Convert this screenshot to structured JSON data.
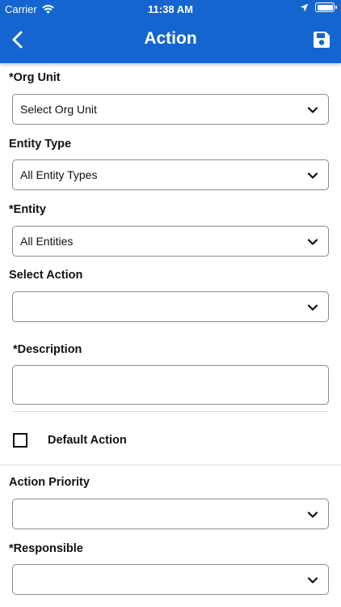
{
  "status_bar": {
    "carrier": "Carrier",
    "time": "11:38 AM",
    "battery_level": 1.0
  },
  "header": {
    "title": "Action",
    "back_icon": "chevron-left-icon",
    "save_icon": "floppy-disk-icon",
    "background_color": "#1565d0"
  },
  "form": {
    "org_unit": {
      "label": "*Org Unit",
      "value": "Select Org Unit"
    },
    "entity_type": {
      "label": "Entity Type",
      "value": "All Entity Types"
    },
    "entity": {
      "label": "*Entity",
      "value": "All Entities"
    },
    "select_action": {
      "label": "Select Action",
      "value": ""
    },
    "description": {
      "label": "*Description",
      "value": ""
    },
    "default_action": {
      "label": "Default Action",
      "checked": false
    },
    "action_priority": {
      "label": "Action Priority",
      "value": ""
    },
    "responsible": {
      "label": "*Responsible",
      "value": ""
    }
  }
}
